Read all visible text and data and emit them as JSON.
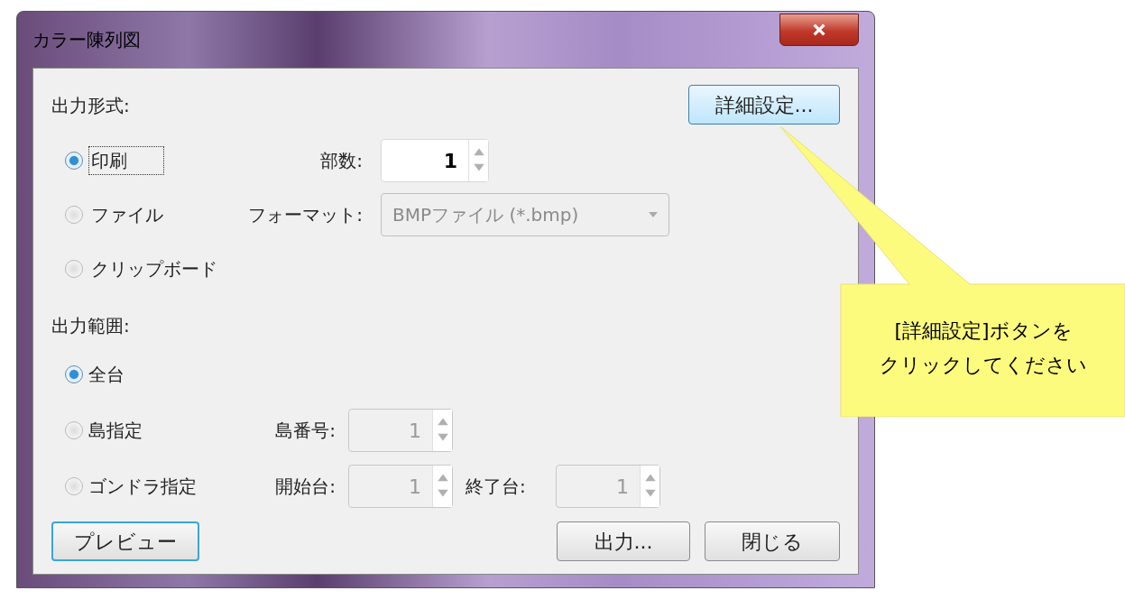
{
  "window": {
    "title": "カラー陳列図"
  },
  "output_format": {
    "label": "出力形式:",
    "settings_button": {
      "label": "詳細設定...",
      "highlighted": true
    },
    "options": [
      {
        "label": "印刷",
        "selected": true,
        "focused": true,
        "kind": "spinner",
        "field_label": "部数:",
        "value": "1",
        "disabled": false
      },
      {
        "label": "ファイル",
        "selected": false,
        "focused": false,
        "kind": "dropdown",
        "field_label": "フォーマット:",
        "value": "BMPファイル (*.bmp)",
        "disabled": true
      },
      {
        "label": "クリップボード",
        "selected": false,
        "focused": false,
        "kind": "none"
      }
    ]
  },
  "output_range": {
    "label": "出力範囲:",
    "options": [
      {
        "label": "全台",
        "selected": true
      },
      {
        "label": "島指定",
        "selected": false,
        "fields": [
          {
            "label": "島番号:",
            "value": "1",
            "disabled": true
          }
        ]
      },
      {
        "label": "ゴンドラ指定",
        "selected": false,
        "fields": [
          {
            "label": "開始台:",
            "value": "1",
            "disabled": true
          },
          {
            "label": "終了台:",
            "value": "1",
            "disabled": true
          }
        ]
      }
    ]
  },
  "buttons": [
    {
      "label": "プレビュー",
      "focused": true
    },
    {
      "label": "出力...",
      "focused": false
    },
    {
      "label": "閉じる",
      "focused": false
    }
  ],
  "callout": {
    "lines": [
      "[詳細設定]ボタンを",
      "クリックしてください"
    ]
  }
}
